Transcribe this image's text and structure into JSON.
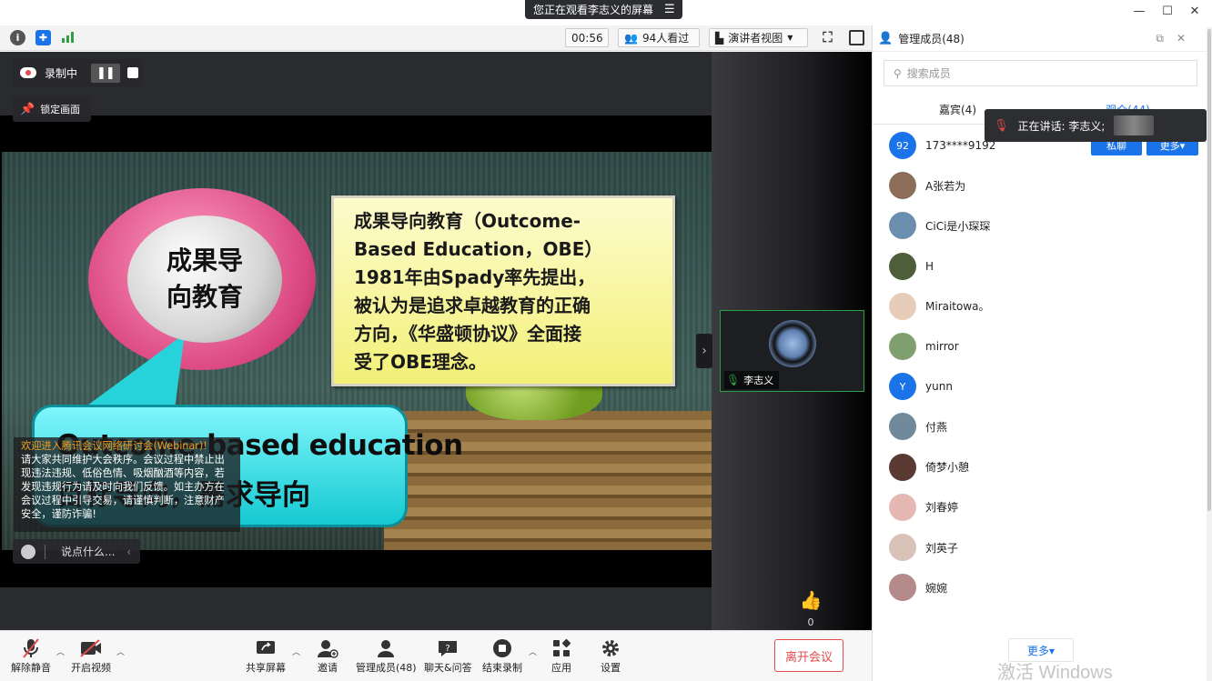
{
  "titlebar": {
    "watching": "您正在观看李志义的屏幕",
    "menu_icon": "menu-icon"
  },
  "infobar": {
    "timer": "00:56",
    "viewers": "94人看过",
    "view_mode": "演讲者视图"
  },
  "recording": {
    "status": "录制中"
  },
  "lock": {
    "label": "锁定画面"
  },
  "slide": {
    "circle_line1": "成果导",
    "circle_line2": "向教育",
    "box_lines": [
      "成果导向教育（Outcome-",
      "Based Education，OBE）",
      "1981年由Spady率先提出，",
      "被认为是追求卓越教育的正确",
      "方向，《华盛顿协议》全面接",
      "受了OBE理念。"
    ],
    "bubble_line1": "Outcome-based education",
    "bubble_line2": "目标导向，需求导向"
  },
  "chat": {
    "welcome": "欢迎进入腾讯会议网络研讨会(Webinar)!",
    "notice": "请大家共同维护大会秩序。会议过程中禁止出现违法违规、低俗色情、吸烟酗酒等内容，若发现违规行为请及时向我们反馈。如主办方在会议过程中引导交易，请谨慎判断，注意财产安全，谨防诈骗!",
    "input_placeholder": "说点什么..."
  },
  "video_tile": {
    "name": "李志义"
  },
  "like": {
    "count": "0"
  },
  "toolbar": {
    "unmute": "解除静音",
    "start_video": "开启视频",
    "share": "共享屏幕",
    "invite": "邀请",
    "members": "管理成员(48)",
    "chat": "聊天&问答",
    "stop_record": "结束录制",
    "apps": "应用",
    "settings": "设置",
    "leave": "离开会议"
  },
  "panel": {
    "title": "管理成员(48)",
    "search_placeholder": "搜索成员",
    "tab_guests": "嘉宾(4)",
    "tab_audience": "观众(44)",
    "speaking": "正在讲话: 李志义;",
    "private_chat": "私聊",
    "more": "更多▾",
    "more_bottom": "更多▾",
    "members": [
      {
        "name": "173****9192",
        "avatar_text": "92",
        "color": "#1a73e8"
      },
      {
        "name": "A张若为",
        "avatar_text": "",
        "color": "#8c6e58"
      },
      {
        "name": "CiCi是小琛琛",
        "avatar_text": "",
        "color": "#6c8fb0"
      },
      {
        "name": "H",
        "avatar_text": "",
        "color": "#4f5e3a"
      },
      {
        "name": "Miraitowa。",
        "avatar_text": "",
        "color": "#e7cdb9"
      },
      {
        "name": "mirror",
        "avatar_text": "",
        "color": "#7f9f6f"
      },
      {
        "name": "yunn",
        "avatar_text": "Y",
        "color": "#1a73e8"
      },
      {
        "name": "付燕",
        "avatar_text": "",
        "color": "#708a9c"
      },
      {
        "name": "倚梦小憩",
        "avatar_text": "",
        "color": "#5b3a34"
      },
      {
        "name": "刘春婷",
        "avatar_text": "",
        "color": "#e5b8b4"
      },
      {
        "name": "刘英子",
        "avatar_text": "",
        "color": "#d9c2b7"
      },
      {
        "name": "婉婉",
        "avatar_text": "",
        "color": "#b58a8a"
      }
    ]
  },
  "watermark": "激活 Windows",
  "colors": {
    "accent": "#1a73e8",
    "leave": "#e14b4b",
    "tile_border": "#2ea043"
  }
}
